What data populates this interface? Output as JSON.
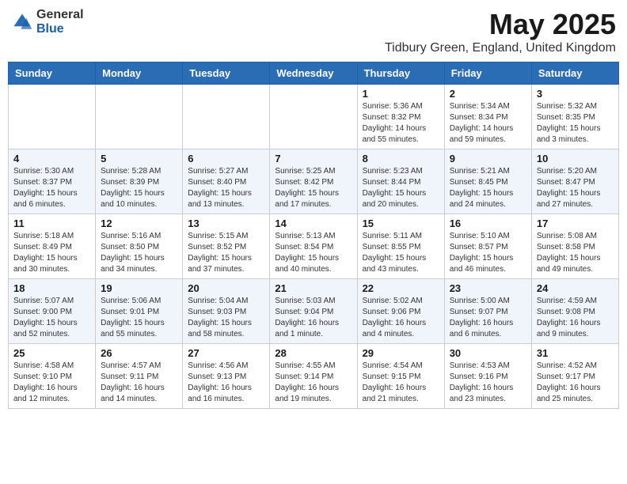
{
  "header": {
    "logo_general": "General",
    "logo_blue": "Blue",
    "month_year": "May 2025",
    "location": "Tidbury Green, England, United Kingdom"
  },
  "weekdays": [
    "Sunday",
    "Monday",
    "Tuesday",
    "Wednesday",
    "Thursday",
    "Friday",
    "Saturday"
  ],
  "weeks": [
    [
      {
        "day": "",
        "info": ""
      },
      {
        "day": "",
        "info": ""
      },
      {
        "day": "",
        "info": ""
      },
      {
        "day": "",
        "info": ""
      },
      {
        "day": "1",
        "info": "Sunrise: 5:36 AM\nSunset: 8:32 PM\nDaylight: 14 hours\nand 55 minutes."
      },
      {
        "day": "2",
        "info": "Sunrise: 5:34 AM\nSunset: 8:34 PM\nDaylight: 14 hours\nand 59 minutes."
      },
      {
        "day": "3",
        "info": "Sunrise: 5:32 AM\nSunset: 8:35 PM\nDaylight: 15 hours\nand 3 minutes."
      }
    ],
    [
      {
        "day": "4",
        "info": "Sunrise: 5:30 AM\nSunset: 8:37 PM\nDaylight: 15 hours\nand 6 minutes."
      },
      {
        "day": "5",
        "info": "Sunrise: 5:28 AM\nSunset: 8:39 PM\nDaylight: 15 hours\nand 10 minutes."
      },
      {
        "day": "6",
        "info": "Sunrise: 5:27 AM\nSunset: 8:40 PM\nDaylight: 15 hours\nand 13 minutes."
      },
      {
        "day": "7",
        "info": "Sunrise: 5:25 AM\nSunset: 8:42 PM\nDaylight: 15 hours\nand 17 minutes."
      },
      {
        "day": "8",
        "info": "Sunrise: 5:23 AM\nSunset: 8:44 PM\nDaylight: 15 hours\nand 20 minutes."
      },
      {
        "day": "9",
        "info": "Sunrise: 5:21 AM\nSunset: 8:45 PM\nDaylight: 15 hours\nand 24 minutes."
      },
      {
        "day": "10",
        "info": "Sunrise: 5:20 AM\nSunset: 8:47 PM\nDaylight: 15 hours\nand 27 minutes."
      }
    ],
    [
      {
        "day": "11",
        "info": "Sunrise: 5:18 AM\nSunset: 8:49 PM\nDaylight: 15 hours\nand 30 minutes."
      },
      {
        "day": "12",
        "info": "Sunrise: 5:16 AM\nSunset: 8:50 PM\nDaylight: 15 hours\nand 34 minutes."
      },
      {
        "day": "13",
        "info": "Sunrise: 5:15 AM\nSunset: 8:52 PM\nDaylight: 15 hours\nand 37 minutes."
      },
      {
        "day": "14",
        "info": "Sunrise: 5:13 AM\nSunset: 8:54 PM\nDaylight: 15 hours\nand 40 minutes."
      },
      {
        "day": "15",
        "info": "Sunrise: 5:11 AM\nSunset: 8:55 PM\nDaylight: 15 hours\nand 43 minutes."
      },
      {
        "day": "16",
        "info": "Sunrise: 5:10 AM\nSunset: 8:57 PM\nDaylight: 15 hours\nand 46 minutes."
      },
      {
        "day": "17",
        "info": "Sunrise: 5:08 AM\nSunset: 8:58 PM\nDaylight: 15 hours\nand 49 minutes."
      }
    ],
    [
      {
        "day": "18",
        "info": "Sunrise: 5:07 AM\nSunset: 9:00 PM\nDaylight: 15 hours\nand 52 minutes."
      },
      {
        "day": "19",
        "info": "Sunrise: 5:06 AM\nSunset: 9:01 PM\nDaylight: 15 hours\nand 55 minutes."
      },
      {
        "day": "20",
        "info": "Sunrise: 5:04 AM\nSunset: 9:03 PM\nDaylight: 15 hours\nand 58 minutes."
      },
      {
        "day": "21",
        "info": "Sunrise: 5:03 AM\nSunset: 9:04 PM\nDaylight: 16 hours\nand 1 minute."
      },
      {
        "day": "22",
        "info": "Sunrise: 5:02 AM\nSunset: 9:06 PM\nDaylight: 16 hours\nand 4 minutes."
      },
      {
        "day": "23",
        "info": "Sunrise: 5:00 AM\nSunset: 9:07 PM\nDaylight: 16 hours\nand 6 minutes."
      },
      {
        "day": "24",
        "info": "Sunrise: 4:59 AM\nSunset: 9:08 PM\nDaylight: 16 hours\nand 9 minutes."
      }
    ],
    [
      {
        "day": "25",
        "info": "Sunrise: 4:58 AM\nSunset: 9:10 PM\nDaylight: 16 hours\nand 12 minutes."
      },
      {
        "day": "26",
        "info": "Sunrise: 4:57 AM\nSunset: 9:11 PM\nDaylight: 16 hours\nand 14 minutes."
      },
      {
        "day": "27",
        "info": "Sunrise: 4:56 AM\nSunset: 9:13 PM\nDaylight: 16 hours\nand 16 minutes."
      },
      {
        "day": "28",
        "info": "Sunrise: 4:55 AM\nSunset: 9:14 PM\nDaylight: 16 hours\nand 19 minutes."
      },
      {
        "day": "29",
        "info": "Sunrise: 4:54 AM\nSunset: 9:15 PM\nDaylight: 16 hours\nand 21 minutes."
      },
      {
        "day": "30",
        "info": "Sunrise: 4:53 AM\nSunset: 9:16 PM\nDaylight: 16 hours\nand 23 minutes."
      },
      {
        "day": "31",
        "info": "Sunrise: 4:52 AM\nSunset: 9:17 PM\nDaylight: 16 hours\nand 25 minutes."
      }
    ]
  ]
}
